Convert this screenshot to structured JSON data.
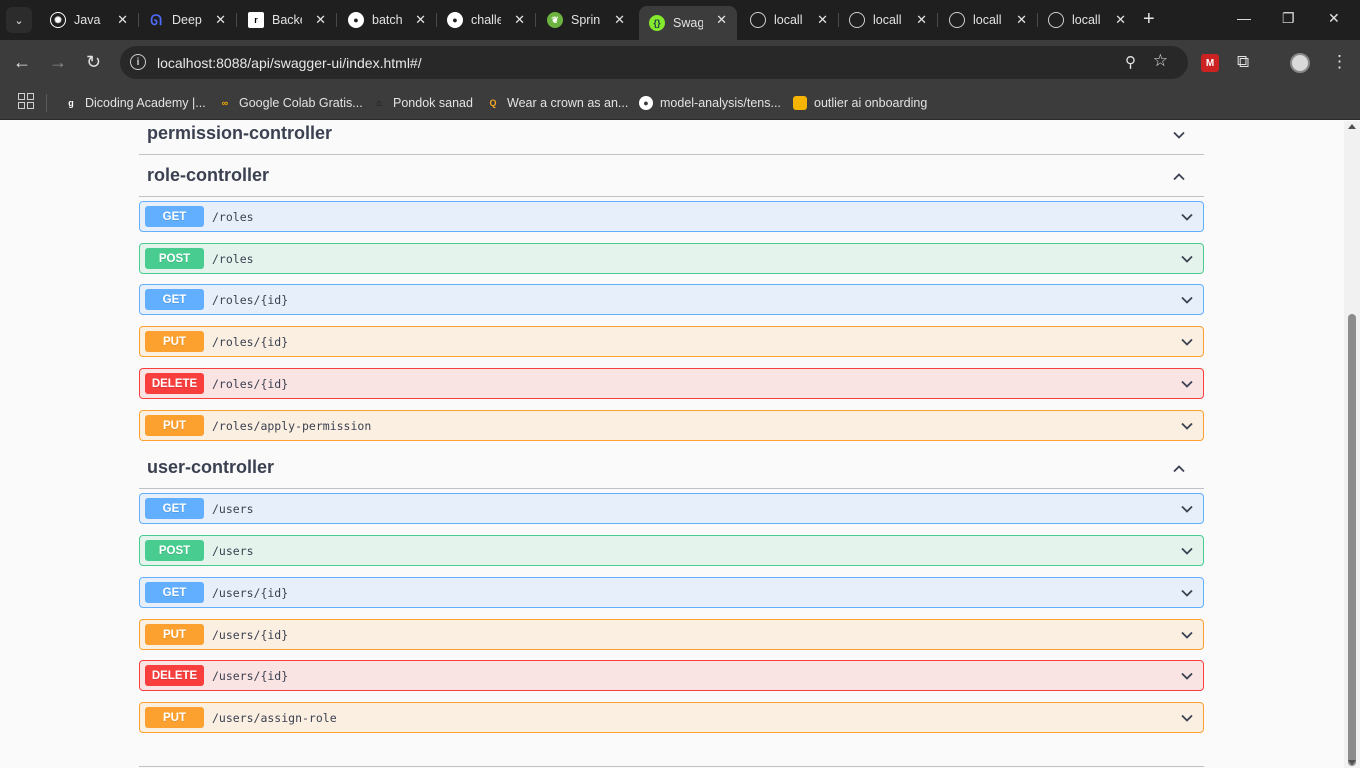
{
  "browser": {
    "tabs": [
      {
        "title": "Java (",
        "favicon": "openai-icon",
        "color": "#ffffff",
        "active": false
      },
      {
        "title": "Deep",
        "favicon": "deepseek-icon",
        "color": "#4d6bfe",
        "active": false
      },
      {
        "title": "Backe",
        "favicon": "app-icon",
        "color": "#ffffff",
        "active": false
      },
      {
        "title": "batch",
        "favicon": "github-icon",
        "color": "#ffffff",
        "active": false
      },
      {
        "title": "challe",
        "favicon": "github-icon",
        "color": "#ffffff",
        "active": false
      },
      {
        "title": "Sprin",
        "favicon": "spring-icon",
        "color": "#6db33f",
        "active": false
      },
      {
        "title": "Swag",
        "favicon": "swagger-icon",
        "color": "#85ea2d",
        "active": true
      },
      {
        "title": "locall",
        "favicon": "globe-icon",
        "color": "#cfcfcf",
        "active": false
      },
      {
        "title": "locall",
        "favicon": "globe-icon",
        "color": "#cfcfcf",
        "active": false
      },
      {
        "title": "locall",
        "favicon": "globe-icon",
        "color": "#cfcfcf",
        "active": false
      },
      {
        "title": "locall",
        "favicon": "globe-icon",
        "color": "#cfcfcf",
        "active": false
      }
    ],
    "url": "localhost:8088/api/swagger-ui/index.html#/",
    "bookmarks": [
      {
        "label": "Dicoding Academy |...",
        "icon": "dicoding-icon"
      },
      {
        "label": "Google Colab Gratis...",
        "icon": "colab-icon"
      },
      {
        "label": "Pondok sanad",
        "icon": "pondok-icon"
      },
      {
        "label": "Wear a crown as an...",
        "icon": "search-orange-icon"
      },
      {
        "label": "model-analysis/tens...",
        "icon": "github-icon"
      },
      {
        "label": "outlier ai onboarding",
        "icon": "slides-icon"
      }
    ]
  },
  "swagger": {
    "sections": [
      {
        "name": "permission-controller",
        "expanded": false,
        "operations": []
      },
      {
        "name": "role-controller",
        "expanded": true,
        "operations": [
          {
            "method": "GET",
            "path": "/roles"
          },
          {
            "method": "POST",
            "path": "/roles"
          },
          {
            "method": "GET",
            "path": "/roles/{id}"
          },
          {
            "method": "PUT",
            "path": "/roles/{id}"
          },
          {
            "method": "DELETE",
            "path": "/roles/{id}"
          },
          {
            "method": "PUT",
            "path": "/roles/apply-permission"
          }
        ]
      },
      {
        "name": "user-controller",
        "expanded": true,
        "operations": [
          {
            "method": "GET",
            "path": "/users"
          },
          {
            "method": "POST",
            "path": "/users"
          },
          {
            "method": "GET",
            "path": "/users/{id}"
          },
          {
            "method": "PUT",
            "path": "/users/{id}"
          },
          {
            "method": "DELETE",
            "path": "/users/{id}"
          },
          {
            "method": "PUT",
            "path": "/users/assign-role"
          }
        ]
      }
    ],
    "colors": {
      "GET": "#61affe",
      "POST": "#49cc90",
      "PUT": "#fca130",
      "DELETE": "#f93e3e"
    }
  }
}
